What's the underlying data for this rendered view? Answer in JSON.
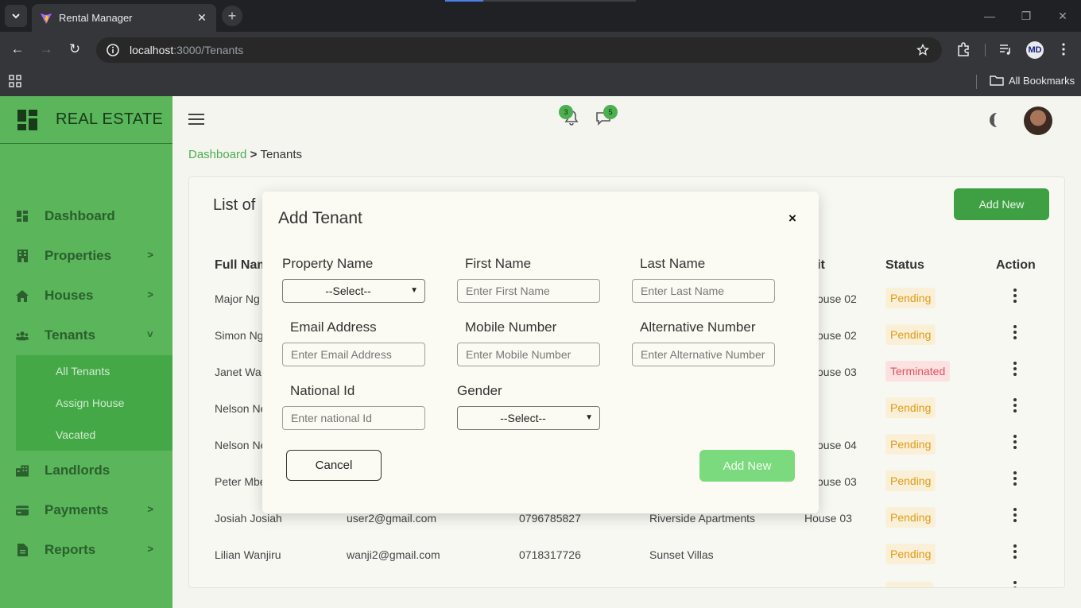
{
  "browser": {
    "tab_title": "Rental Manager",
    "url_host": "localhost",
    "url_path": ":3000/Tenants",
    "bookmarks_label": "All Bookmarks"
  },
  "sidebar": {
    "brand": "REAL ESTATE",
    "items": [
      {
        "label": "Dashboard",
        "icon": "dashboard-icon",
        "has_chevron": false
      },
      {
        "label": "Properties",
        "icon": "building-icon",
        "has_chevron": true
      },
      {
        "label": "Houses",
        "icon": "home-icon",
        "has_chevron": true
      },
      {
        "label": "Tenants",
        "icon": "users-icon",
        "has_chevron": true,
        "expanded": true
      },
      {
        "label": "Landlords",
        "icon": "city-icon",
        "has_chevron": false
      },
      {
        "label": "Payments",
        "icon": "card-icon",
        "has_chevron": true
      },
      {
        "label": "Reports",
        "icon": "file-icon",
        "has_chevron": true
      }
    ],
    "tenant_submenu": [
      "All Tenants",
      "Assign House",
      "Vacated"
    ]
  },
  "topbar": {
    "notifications_count": "3",
    "messages_count": "5"
  },
  "breadcrumb": {
    "root": "Dashboard",
    "current": "Tenants"
  },
  "card": {
    "title": "List of",
    "add_button": "Add New",
    "columns": [
      "Full Nam",
      "it",
      "Status",
      "Action"
    ],
    "rows": [
      {
        "name": "Major Ng",
        "email": "",
        "phone": "",
        "property": "",
        "unit": "ouse 02",
        "status": "Pending"
      },
      {
        "name": "Simon Ng",
        "email": "",
        "phone": "",
        "property": "",
        "unit": "ouse 02",
        "status": "Pending"
      },
      {
        "name": "Janet Wa",
        "email": "",
        "phone": "",
        "property": "",
        "unit": "ouse 03",
        "status": "Terminated"
      },
      {
        "name": "Nelson Ne",
        "email": "",
        "phone": "",
        "property": "",
        "unit": "",
        "status": "Pending"
      },
      {
        "name": "Nelson Ne",
        "email": "",
        "phone": "",
        "property": "",
        "unit": "ouse 04",
        "status": "Pending"
      },
      {
        "name": "Peter Mbe",
        "email": "",
        "phone": "",
        "property": "",
        "unit": "ouse 03",
        "status": "Pending"
      },
      {
        "name": "Josiah Josiah",
        "email": "user2@gmail.com",
        "phone": "0796785827",
        "property": "Riverside Apartments",
        "unit": "House 03",
        "status": "Pending"
      },
      {
        "name": "Lilian Wanjiru",
        "email": "wanji2@gmail.com",
        "phone": "0718317726",
        "property": "Sunset Villas",
        "unit": "",
        "status": "Pending"
      }
    ]
  },
  "modal": {
    "title": "Add Tenant",
    "close": "×",
    "labels": {
      "property": "Property Name",
      "first": "First Name",
      "last": "Last Name",
      "email": "Email Address",
      "mobile": "Mobile Number",
      "alt": "Alternative Number",
      "national": "National Id",
      "gender": "Gender"
    },
    "placeholders": {
      "first": "Enter First Name",
      "last": "Enter Last Name",
      "email": "Enter Email Address",
      "mobile": "Enter Mobile Number",
      "alt": "Enter Alternative Number",
      "national": "Enter national Id"
    },
    "select_default": "--Select--",
    "cancel": "Cancel",
    "submit": "Add New"
  },
  "colors": {
    "sidebar": "#5ab55b",
    "accent": "#4caf50",
    "pending": "#e09b1a",
    "terminated": "#e0525c"
  }
}
